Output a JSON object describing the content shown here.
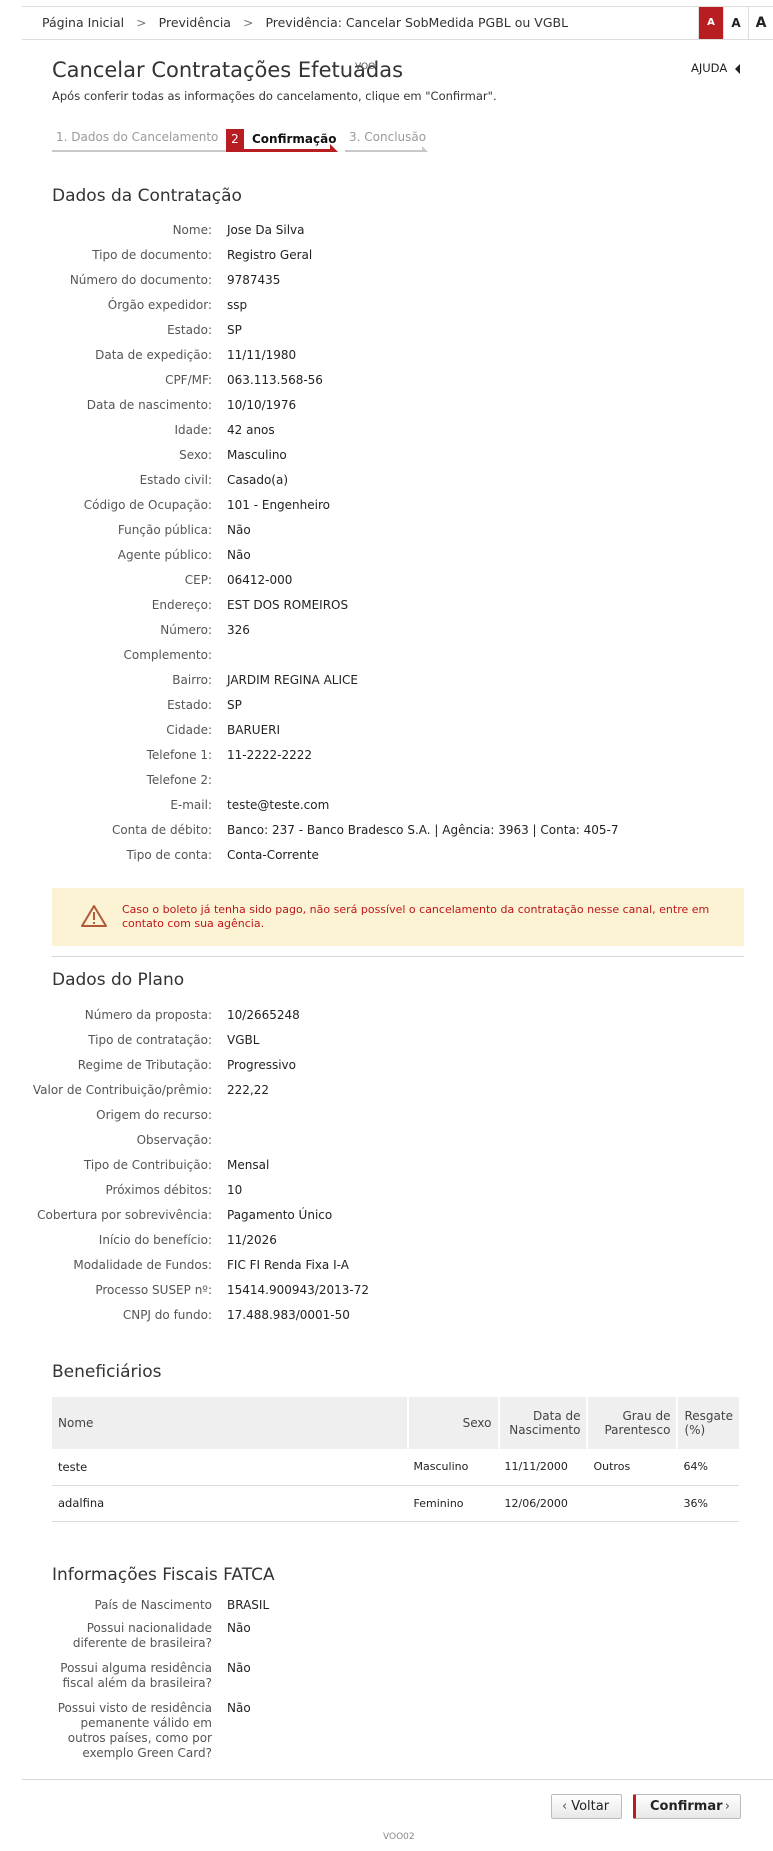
{
  "breadcrumb": [
    "Página Inicial",
    "Previdência",
    "Previdência: Cancelar SobMedida PGBL ou VGBL"
  ],
  "font_size_controls": [
    "A",
    "A",
    "A"
  ],
  "header": {
    "title": "Cancelar Contratações Efetuadas",
    "code": "VOO",
    "help": "AJUDA",
    "subtitle": "Após conferir todas as informações do cancelamento, clique em \"Confirmar\"."
  },
  "steps": [
    {
      "label": "1. Dados do Cancelamento",
      "state": "done"
    },
    {
      "number": "2",
      "label": "Confirmação",
      "state": "active"
    },
    {
      "label": "3. Conclusão",
      "state": "pending"
    }
  ],
  "contratacao": {
    "title": "Dados da Contratação",
    "rows": [
      {
        "k": "Nome:",
        "v": "Jose Da Silva"
      },
      {
        "k": "Tipo de documento:",
        "v": "Registro Geral"
      },
      {
        "k": "Número do documento:",
        "v": "9787435"
      },
      {
        "k": "Órgão expedidor:",
        "v": "ssp"
      },
      {
        "k": "Estado:",
        "v": "SP"
      },
      {
        "k": "Data de expedição:",
        "v": "11/11/1980"
      },
      {
        "k": "CPF/MF:",
        "v": "063.113.568-56"
      },
      {
        "k": "Data de nascimento:",
        "v": "10/10/1976"
      },
      {
        "k": "Idade:",
        "v": "42 anos"
      },
      {
        "k": "Sexo:",
        "v": "Masculino"
      },
      {
        "k": "Estado civil:",
        "v": "Casado(a)"
      },
      {
        "k": "Código de Ocupação:",
        "v": "101 - Engenheiro"
      },
      {
        "k": "Função pública:",
        "v": "Não"
      },
      {
        "k": "Agente público:",
        "v": "Não"
      },
      {
        "k": "CEP:",
        "v": "06412-000"
      },
      {
        "k": "Endereço:",
        "v": "EST DOS ROMEIROS"
      },
      {
        "k": "Número:",
        "v": "326"
      },
      {
        "k": "Complemento:",
        "v": ""
      },
      {
        "k": "Bairro:",
        "v": "JARDIM REGINA ALICE"
      },
      {
        "k": "Estado:",
        "v": "SP"
      },
      {
        "k": "Cidade:",
        "v": "BARUERI"
      },
      {
        "k": "Telefone 1:",
        "v": "11-2222-2222"
      },
      {
        "k": "Telefone 2:",
        "v": ""
      },
      {
        "k": "E-mail:",
        "v": "teste@teste.com"
      },
      {
        "k": "Conta de débito:",
        "v": "Banco: 237 - Banco Bradesco S.A. | Agência: 3963 | Conta: 405-7"
      },
      {
        "k": "Tipo de conta:",
        "v": "Conta-Corrente"
      }
    ]
  },
  "warning": {
    "text": "Caso o boleto já tenha sido pago, não será possível o cancelamento da contratação nesse canal, entre em contato com sua agência."
  },
  "plano": {
    "title": "Dados do Plano",
    "rows": [
      {
        "k": "Número da proposta:",
        "v": "10/2665248"
      },
      {
        "k": "Tipo de contratação:",
        "v": "VGBL"
      },
      {
        "k": "Regime de Tributação:",
        "v": "Progressivo"
      },
      {
        "k": "Valor de Contribuição/prêmio:",
        "v": "222,22"
      },
      {
        "k": "Origem do recurso:",
        "v": ""
      },
      {
        "k": "Observação:",
        "v": ""
      },
      {
        "k": "Tipo de Contribuição:",
        "v": "Mensal"
      },
      {
        "k": "Próximos débitos:",
        "v": "10"
      },
      {
        "k": "Cobertura por sobrevivência:",
        "v": "Pagamento Único"
      },
      {
        "k": "Início do benefício:",
        "v": "11/2026"
      },
      {
        "k": "Modalidade de Fundos:",
        "v": "FIC FI Renda Fixa I-A"
      },
      {
        "k": "Processo SUSEP nº:",
        "v": "15414.900943/2013-72"
      },
      {
        "k": "CNPJ do fundo:",
        "v": "17.488.983/0001-50"
      }
    ]
  },
  "beneficiarios": {
    "title": "Beneficiários",
    "headers": [
      "Nome",
      "Sexo",
      "Data de Nascimento",
      "Grau de Parentesco",
      "Resgate (%)"
    ],
    "rows": [
      [
        "teste",
        "Masculino",
        "11/11/2000",
        "Outros",
        "64%"
      ],
      [
        "adalfina",
        "Feminino",
        "12/06/2000",
        "",
        "36%"
      ]
    ]
  },
  "fatca": {
    "title": "Informações Fiscais FATCA",
    "rows": [
      {
        "k": "País de Nascimento",
        "v": "BRASIL"
      },
      {
        "k": "Possui nacionalidade diferente de brasileira?",
        "v": "Não"
      },
      {
        "k": "Possui alguma residência fiscal além da brasileira?",
        "v": "Não"
      },
      {
        "k": "Possui visto de residência pemanente válido em outros países, como por exemplo Green Card?",
        "v": "Não"
      }
    ]
  },
  "footer": {
    "back": "Voltar",
    "confirm": "Confirmar",
    "code": "VOO02"
  },
  "colors": {
    "brand_red": "#b81d22",
    "warning_bg": "#fbf3d4",
    "warning_text": "#c0161b"
  }
}
